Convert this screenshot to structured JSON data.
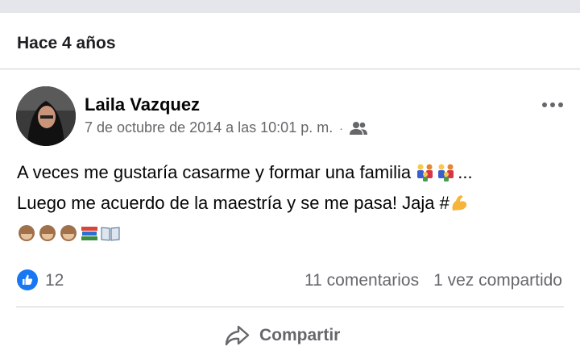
{
  "memory": {
    "title": "Hace 4 años"
  },
  "post": {
    "author": "Laila Vazquez",
    "timestamp": "7 de octubre de 2014 a las 10:01 p. m.",
    "separator": "·",
    "audience_icon": "friends-icon",
    "text_line1": "A veces me gustaría casarme y formar una familia",
    "text_line1_suffix": "...",
    "text_line2": "Luego me acuerdo de  la maestría y se me pasa! Jaja #",
    "emojis_line1": [
      "family-emoji",
      "family-emoji"
    ],
    "emojis_line2": [
      "flexed-biceps-emoji"
    ],
    "emojis_line3": [
      "see-no-evil-monkey-emoji",
      "see-no-evil-monkey-emoji",
      "see-no-evil-monkey-emoji",
      "books-emoji",
      "open-book-emoji"
    ]
  },
  "stats": {
    "likes": "12",
    "comments": "11 comentarios",
    "shares": "1 vez compartido"
  },
  "actions": {
    "share_label": "Compartir"
  },
  "colors": {
    "accent": "#1877f2",
    "muted": "#65676b",
    "divider": "#ced0d4"
  }
}
